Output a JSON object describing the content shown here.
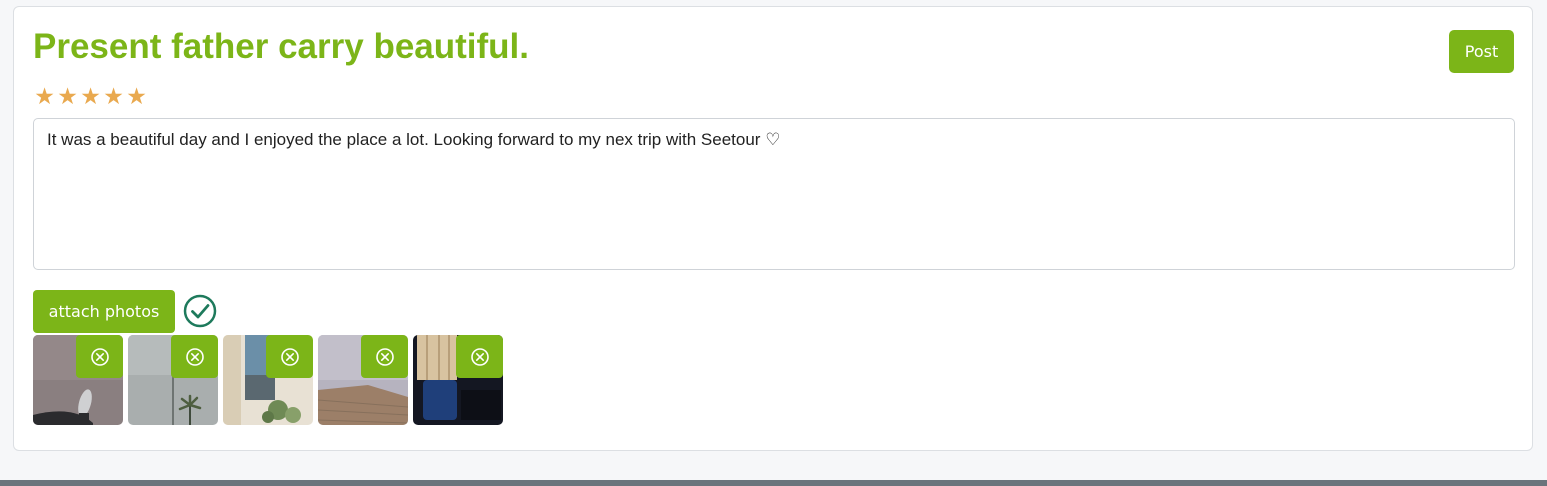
{
  "review": {
    "title": "Present father carry beautiful.",
    "post_label": "Post",
    "rating": 5,
    "stars": [
      "★",
      "★",
      "★",
      "★",
      "★"
    ],
    "body_text": "It was a beautiful day and I enjoyed the place a lot. Looking forward to my nex trip with Seetour ♡",
    "attach_label": "attach photos",
    "attached": true,
    "photos": [
      {
        "description": "foot on ground"
      },
      {
        "description": "palm tree, cloudy sky"
      },
      {
        "description": "building with plants"
      },
      {
        "description": "brick wall, sky"
      },
      {
        "description": "room with window"
      }
    ]
  },
  "colors": {
    "accent": "#7cb518",
    "star": "#e9a94f",
    "check": "#1e7a5c",
    "footer": "#6b747c"
  },
  "icons": {
    "rating": "star-icon",
    "upload_status": "check-circle-icon",
    "remove_photo": "close-circle-icon"
  }
}
